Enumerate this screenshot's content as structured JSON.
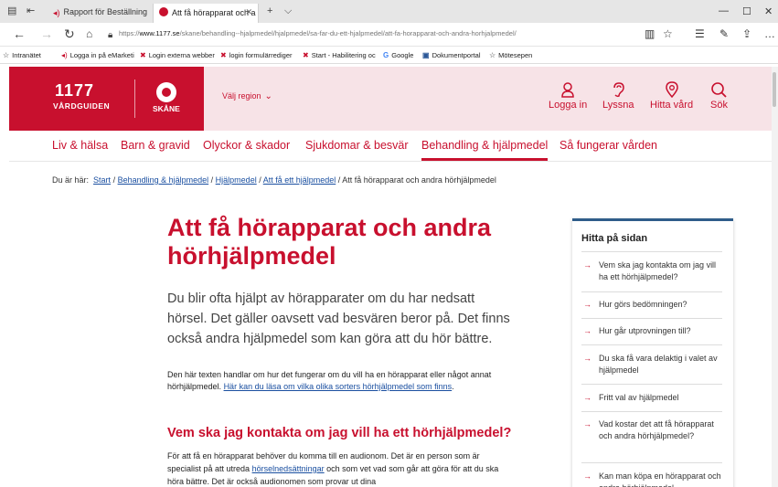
{
  "browser": {
    "tabs": [
      {
        "title": "Rapport för Beställning beh",
        "active": false
      },
      {
        "title": "Att få hörapparat och a",
        "active": true
      }
    ],
    "new_tab_glyph": "+",
    "tab_menu_glyph": "⌵",
    "url_prefix": "https://",
    "url_domain": "www.1177.se",
    "url_path": "/skane/behandling--hjalpmedel/hjalpmedel/sa-far-du-ett-hjalpmedel/att-fa-horapparat-och-andra-horhjalpmedel/",
    "favorites": [
      {
        "label": "Intranätet",
        "icon": "star-icon"
      },
      {
        "label": "Logga in på eMarketi",
        "icon": "audio-icon"
      },
      {
        "label": "Login externa webber",
        "icon": "red-logo-icon"
      },
      {
        "label": "login formulärrediger",
        "icon": "red-logo-icon"
      },
      {
        "label": "Start - Habilitering oc",
        "icon": "red-logo-icon"
      },
      {
        "label": "Google",
        "icon": "google-icon"
      },
      {
        "label": "Dokumentportal",
        "icon": "document-icon"
      },
      {
        "label": "Mötesepen",
        "icon": "star-icon"
      }
    ]
  },
  "site": {
    "logo_number": "1177",
    "logo_name": "VÅRDGUIDEN",
    "region_logo": "SKÅNE",
    "region_select": "Välj region",
    "header_buttons": [
      {
        "label": "Logga in",
        "icon": "person-icon"
      },
      {
        "label": "Lyssna",
        "icon": "ear-icon"
      },
      {
        "label": "Hitta vård",
        "icon": "map-pin-icon"
      },
      {
        "label": "Sök",
        "icon": "search-icon"
      }
    ],
    "nav": [
      {
        "label": "Liv & hälsa",
        "active": false
      },
      {
        "label": "Barn & gravid",
        "active": false
      },
      {
        "label": "Olyckor & skador",
        "active": false
      },
      {
        "label": "Sjukdomar & besvär",
        "active": false
      },
      {
        "label": "Behandling & hjälpmedel",
        "active": true
      },
      {
        "label": "Så fungerar vården",
        "active": false
      }
    ],
    "colors": {
      "brand": "#c8102e",
      "pink": "#f7e3e7",
      "link": "#1a4fa0"
    }
  },
  "breadcrumb": {
    "prefix": "Du är här:",
    "links": [
      "Start",
      "Behandling & hjälpmedel",
      "Hjälpmedel",
      "Att få ett hjälpmedel"
    ],
    "current": "Att få hörapparat och andra hörhjälpmedel"
  },
  "article": {
    "title": "Att få hörapparat och andra hörhjälpmedel",
    "lead": "Du blir ofta hjälpt av hörapparater om du har nedsatt hörsel. Det gäller oavsett vad besvären beror på. Det finns också andra hjälpmedel som kan göra att du hör bättre.",
    "intro_text": "Den här texten handlar om hur det fungerar om du vill ha en hörapparat eller något annat hörhjälpmedel.",
    "intro_link": "Här kan du läsa om vilka olika sorters hörhjälpmedel som finns",
    "intro_end": ".",
    "section_title": "Vem ska jag kontakta om jag vill ha ett hörhjälpmedel?",
    "body_1": "För att få en hörapparat behöver du komma till en audionom. Det är en person som är specialist på att utreda",
    "body_link": "hörselnedsättningar",
    "body_2": "och som vet vad som går att göra för att du ska höra bättre. Det är också audionomen som provar ut dina"
  },
  "toc": {
    "title": "Hitta på sidan",
    "items": [
      "Vem ska jag kontakta om jag vill ha ett hörhjälpmedel?",
      "Hur görs bedömningen?",
      "Hur går utprovningen till?",
      "Du ska få vara delaktig i valet av hjälpmedel",
      "Fritt val av hjälpmedel",
      "Vad kostar det att få hörapparat och andra hörhjälpmedel?",
      "Kan man köpa en hörapparat och andra hörhjälpmedel"
    ]
  }
}
